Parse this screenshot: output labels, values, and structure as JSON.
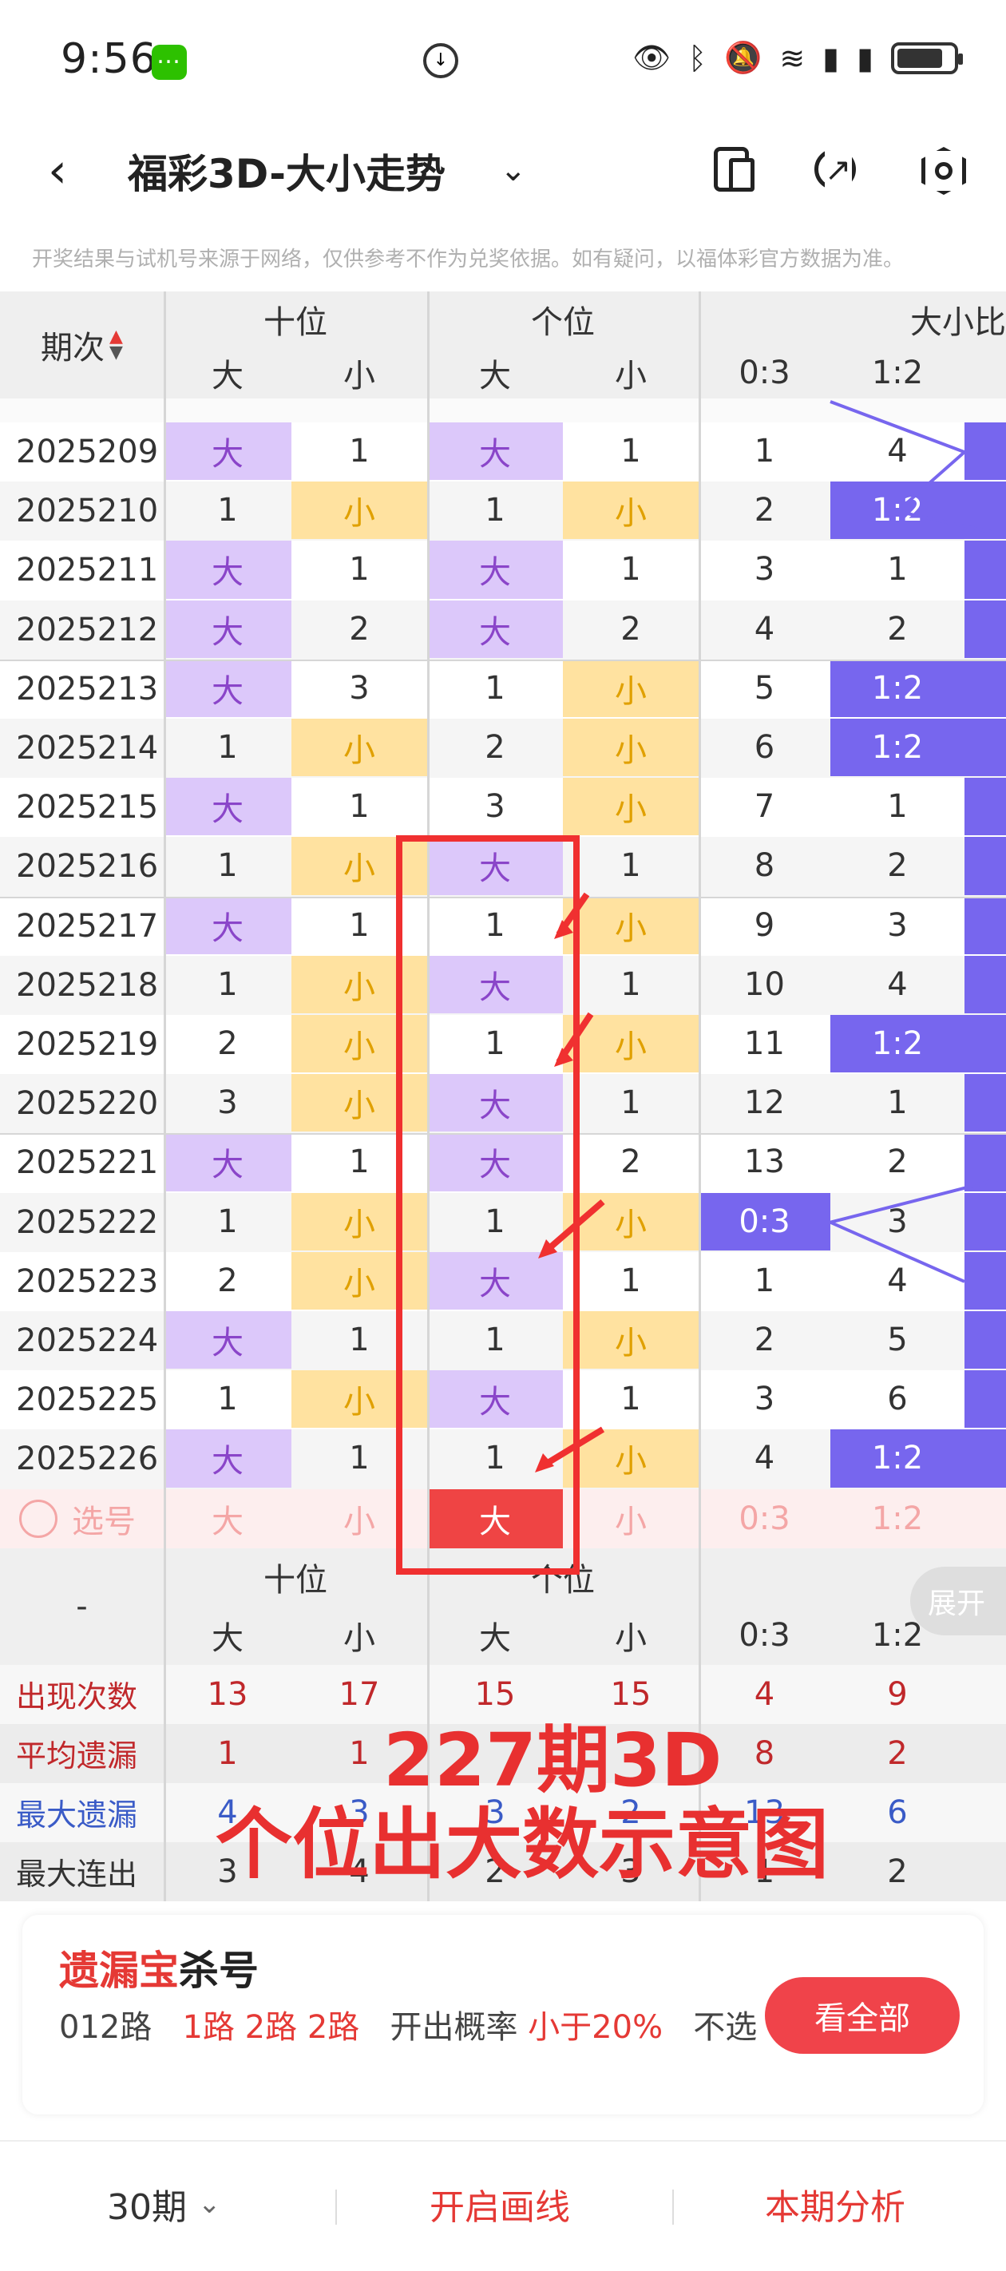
{
  "status": {
    "time": "9:56"
  },
  "header": {
    "title": "福彩3D-大小走势",
    "notice": "开奖结果与试机号来源于网络，仅供参考不作为兑奖依据。如有疑问，以福体彩官方数据为准。"
  },
  "table": {
    "period_header": "期次",
    "groups": [
      "十位",
      "个位",
      "大小比"
    ],
    "subheaders": [
      "大",
      "小",
      "大",
      "小",
      "0:3",
      "1:2"
    ],
    "rows": [
      {
        "p": "2025209",
        "c": [
          "大",
          "1",
          "大",
          "1",
          "1",
          "4"
        ],
        "s": [
          "P",
          "W",
          "P",
          "W",
          "W",
          "W"
        ]
      },
      {
        "p": "2025210",
        "c": [
          "1",
          "小",
          "1",
          "小",
          "2",
          "1:2"
        ],
        "s": [
          "W",
          "Y",
          "W",
          "Y",
          "W",
          "B"
        ]
      },
      {
        "p": "2025211",
        "c": [
          "大",
          "1",
          "大",
          "1",
          "3",
          "1"
        ],
        "s": [
          "P",
          "W",
          "P",
          "W",
          "W",
          "W"
        ]
      },
      {
        "p": "2025212",
        "c": [
          "大",
          "2",
          "大",
          "2",
          "4",
          "2"
        ],
        "s": [
          "P",
          "W",
          "P",
          "W",
          "W",
          "W"
        ]
      },
      {
        "p": "2025213",
        "c": [
          "大",
          "3",
          "1",
          "小",
          "5",
          "1:2"
        ],
        "s": [
          "P",
          "W",
          "W",
          "Y",
          "W",
          "B"
        ]
      },
      {
        "p": "2025214",
        "c": [
          "1",
          "小",
          "2",
          "小",
          "6",
          "1:2"
        ],
        "s": [
          "W",
          "Y",
          "W",
          "Y",
          "W",
          "B"
        ]
      },
      {
        "p": "2025215",
        "c": [
          "大",
          "1",
          "3",
          "小",
          "7",
          "1"
        ],
        "s": [
          "P",
          "W",
          "W",
          "Y",
          "W",
          "W"
        ]
      },
      {
        "p": "2025216",
        "c": [
          "1",
          "小",
          "大",
          "1",
          "8",
          "2"
        ],
        "s": [
          "W",
          "Y",
          "P",
          "W",
          "W",
          "W"
        ]
      },
      {
        "p": "2025217",
        "c": [
          "大",
          "1",
          "1",
          "小",
          "9",
          "3"
        ],
        "s": [
          "P",
          "W",
          "W",
          "Y",
          "W",
          "W"
        ]
      },
      {
        "p": "2025218",
        "c": [
          "1",
          "小",
          "大",
          "1",
          "10",
          "4"
        ],
        "s": [
          "W",
          "Y",
          "P",
          "W",
          "W",
          "W"
        ]
      },
      {
        "p": "2025219",
        "c": [
          "2",
          "小",
          "1",
          "小",
          "11",
          "1:2"
        ],
        "s": [
          "W",
          "Y",
          "W",
          "Y",
          "W",
          "B"
        ]
      },
      {
        "p": "2025220",
        "c": [
          "3",
          "小",
          "大",
          "1",
          "12",
          "1"
        ],
        "s": [
          "W",
          "Y",
          "P",
          "W",
          "W",
          "W"
        ]
      },
      {
        "p": "2025221",
        "c": [
          "大",
          "1",
          "大",
          "2",
          "13",
          "2"
        ],
        "s": [
          "P",
          "W",
          "P",
          "W",
          "W",
          "W"
        ]
      },
      {
        "p": "2025222",
        "c": [
          "1",
          "小",
          "1",
          "小",
          "0:3",
          "3"
        ],
        "s": [
          "W",
          "Y",
          "W",
          "Y",
          "B",
          "W"
        ]
      },
      {
        "p": "2025223",
        "c": [
          "2",
          "小",
          "大",
          "1",
          "1",
          "4"
        ],
        "s": [
          "W",
          "Y",
          "P",
          "W",
          "W",
          "W"
        ]
      },
      {
        "p": "2025224",
        "c": [
          "大",
          "1",
          "1",
          "小",
          "2",
          "5"
        ],
        "s": [
          "P",
          "W",
          "W",
          "Y",
          "W",
          "W"
        ]
      },
      {
        "p": "2025225",
        "c": [
          "1",
          "小",
          "大",
          "1",
          "3",
          "6"
        ],
        "s": [
          "W",
          "Y",
          "P",
          "W",
          "W",
          "W"
        ]
      },
      {
        "p": "2025226",
        "c": [
          "大",
          "1",
          "1",
          "小",
          "4",
          "1:2"
        ],
        "s": [
          "P",
          "W",
          "W",
          "Y",
          "W",
          "B"
        ]
      }
    ],
    "select_row": {
      "label": "选号",
      "c": [
        "大",
        "小",
        "大",
        "小",
        "0:3",
        "1:2"
      ]
    },
    "footer_groups": [
      "十位",
      "个位"
    ],
    "footer_dash": "-",
    "stats": [
      {
        "label": "出现次数",
        "v": [
          "13",
          "17",
          "15",
          "15",
          "4",
          "9"
        ],
        "color": "red"
      },
      {
        "label": "平均遗漏",
        "v": [
          "1",
          "1",
          "",
          "",
          "8",
          "2"
        ],
        "color": "red"
      },
      {
        "label": "最大遗漏",
        "v": [
          "4",
          "3",
          "3",
          "2",
          "13",
          "6"
        ],
        "color": "blue"
      },
      {
        "label": "最大连出",
        "v": [
          "3",
          "4",
          "2",
          "3",
          "1",
          "2"
        ],
        "color": "dark"
      }
    ]
  },
  "expand_label": "展开",
  "overlay": {
    "line1": "227期3D",
    "line2": "个位出大数示意图"
  },
  "card": {
    "title_red": "遗漏宝",
    "title_dark": "杀号",
    "text_a": "012路",
    "text_b": "1路 2路 2路",
    "text_c": "开出概率",
    "text_d": "小于20%",
    "text_e": "不选",
    "button": "看全部"
  },
  "bottom": {
    "period": "30期",
    "draw": "开启画线",
    "analysis": "本期分析"
  },
  "colors": {
    "accent": "#e53935",
    "purple": "#dcc8fa",
    "yellow": "#ffe2a0",
    "blue": "#7766ee"
  }
}
